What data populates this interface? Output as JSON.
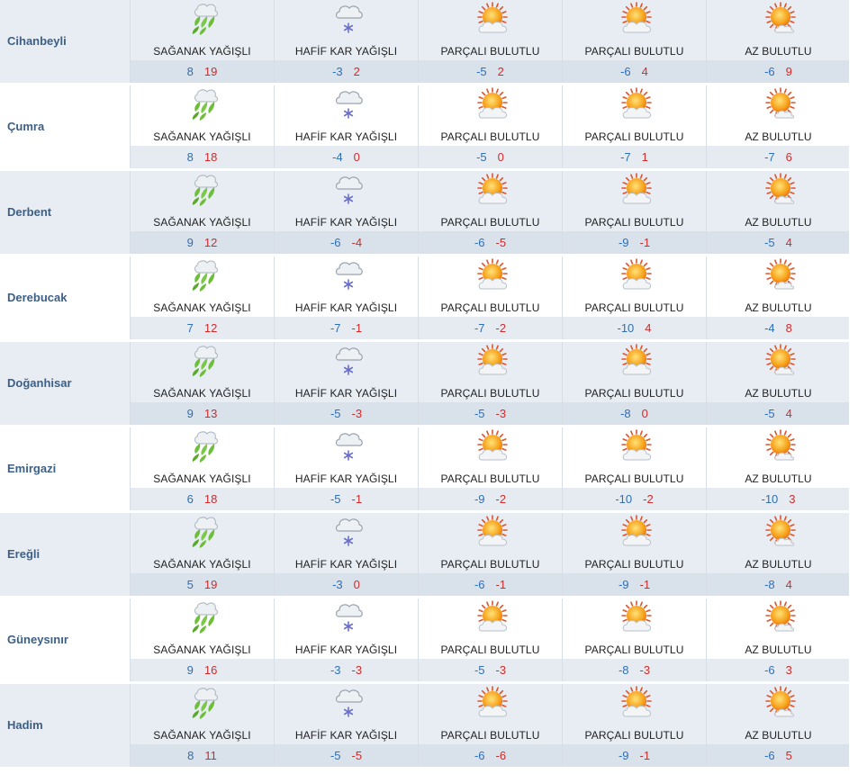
{
  "columns": [
    "col1",
    "col2",
    "col3",
    "col4",
    "col5"
  ],
  "icons": {
    "shower": "shower-rain-icon",
    "snow": "light-snow-icon",
    "partly": "partly-cloudy-icon",
    "few": "few-clouds-icon"
  },
  "colors": {
    "min_temp": "#2f6fb3",
    "max_temp": "#d02b2b",
    "city": "#3c5f86"
  },
  "rows": [
    {
      "city": "Cihanbeyli",
      "days": [
        {
          "cond": "SAĞANAK YAĞIŞLI",
          "icon": "shower",
          "min": "8",
          "max": "19"
        },
        {
          "cond": "HAFİF KAR YAĞIŞLI",
          "icon": "snow",
          "min": "-3",
          "max": "2"
        },
        {
          "cond": "PARÇALI BULUTLU",
          "icon": "partly",
          "min": "-5",
          "max": "2"
        },
        {
          "cond": "PARÇALI BULUTLU",
          "icon": "partly",
          "min": "-6",
          "max": "4"
        },
        {
          "cond": "AZ BULUTLU",
          "icon": "few",
          "min": "-6",
          "max": "9"
        }
      ]
    },
    {
      "city": "Çumra",
      "days": [
        {
          "cond": "SAĞANAK YAĞIŞLI",
          "icon": "shower",
          "min": "8",
          "max": "18"
        },
        {
          "cond": "HAFİF KAR YAĞIŞLI",
          "icon": "snow",
          "min": "-4",
          "max": "0"
        },
        {
          "cond": "PARÇALI BULUTLU",
          "icon": "partly",
          "min": "-5",
          "max": "0"
        },
        {
          "cond": "PARÇALI BULUTLU",
          "icon": "partly",
          "min": "-7",
          "max": "1"
        },
        {
          "cond": "AZ BULUTLU",
          "icon": "few",
          "min": "-7",
          "max": "6"
        }
      ]
    },
    {
      "city": "Derbent",
      "days": [
        {
          "cond": "SAĞANAK YAĞIŞLI",
          "icon": "shower",
          "min": "9",
          "max": "12"
        },
        {
          "cond": "HAFİF KAR YAĞIŞLI",
          "icon": "snow",
          "min": "-6",
          "max": "-4"
        },
        {
          "cond": "PARÇALI BULUTLU",
          "icon": "partly",
          "min": "-6",
          "max": "-5"
        },
        {
          "cond": "PARÇALI BULUTLU",
          "icon": "partly",
          "min": "-9",
          "max": "-1"
        },
        {
          "cond": "AZ BULUTLU",
          "icon": "few",
          "min": "-5",
          "max": "4"
        }
      ]
    },
    {
      "city": "Derebucak",
      "days": [
        {
          "cond": "SAĞANAK YAĞIŞLI",
          "icon": "shower",
          "min": "7",
          "max": "12"
        },
        {
          "cond": "HAFİF KAR YAĞIŞLI",
          "icon": "snow",
          "min": "-7",
          "max": "-1"
        },
        {
          "cond": "PARÇALI BULUTLU",
          "icon": "partly",
          "min": "-7",
          "max": "-2"
        },
        {
          "cond": "PARÇALI BULUTLU",
          "icon": "partly",
          "min": "-10",
          "max": "4"
        },
        {
          "cond": "AZ BULUTLU",
          "icon": "few",
          "min": "-4",
          "max": "8"
        }
      ]
    },
    {
      "city": "Doğanhisar",
      "days": [
        {
          "cond": "SAĞANAK YAĞIŞLI",
          "icon": "shower",
          "min": "9",
          "max": "13"
        },
        {
          "cond": "HAFİF KAR YAĞIŞLI",
          "icon": "snow",
          "min": "-5",
          "max": "-3"
        },
        {
          "cond": "PARÇALI BULUTLU",
          "icon": "partly",
          "min": "-5",
          "max": "-3"
        },
        {
          "cond": "PARÇALI BULUTLU",
          "icon": "partly",
          "min": "-8",
          "max": "0"
        },
        {
          "cond": "AZ BULUTLU",
          "icon": "few",
          "min": "-5",
          "max": "4"
        }
      ]
    },
    {
      "city": "Emirgazi",
      "days": [
        {
          "cond": "SAĞANAK YAĞIŞLI",
          "icon": "shower",
          "min": "6",
          "max": "18"
        },
        {
          "cond": "HAFİF KAR YAĞIŞLI",
          "icon": "snow",
          "min": "-5",
          "max": "-1"
        },
        {
          "cond": "PARÇALI BULUTLU",
          "icon": "partly",
          "min": "-9",
          "max": "-2"
        },
        {
          "cond": "PARÇALI BULUTLU",
          "icon": "partly",
          "min": "-10",
          "max": "-2"
        },
        {
          "cond": "AZ BULUTLU",
          "icon": "few",
          "min": "-10",
          "max": "3"
        }
      ]
    },
    {
      "city": "Ereğli",
      "days": [
        {
          "cond": "SAĞANAK YAĞIŞLI",
          "icon": "shower",
          "min": "5",
          "max": "19"
        },
        {
          "cond": "HAFİF KAR YAĞIŞLI",
          "icon": "snow",
          "min": "-3",
          "max": "0"
        },
        {
          "cond": "PARÇALI BULUTLU",
          "icon": "partly",
          "min": "-6",
          "max": "-1"
        },
        {
          "cond": "PARÇALI BULUTLU",
          "icon": "partly",
          "min": "-9",
          "max": "-1"
        },
        {
          "cond": "AZ BULUTLU",
          "icon": "few",
          "min": "-8",
          "max": "4"
        }
      ]
    },
    {
      "city": "Güneysınır",
      "days": [
        {
          "cond": "SAĞANAK YAĞIŞLI",
          "icon": "shower",
          "min": "9",
          "max": "16"
        },
        {
          "cond": "HAFİF KAR YAĞIŞLI",
          "icon": "snow",
          "min": "-3",
          "max": "-3"
        },
        {
          "cond": "PARÇALI BULUTLU",
          "icon": "partly",
          "min": "-5",
          "max": "-3"
        },
        {
          "cond": "PARÇALI BULUTLU",
          "icon": "partly",
          "min": "-8",
          "max": "-3"
        },
        {
          "cond": "AZ BULUTLU",
          "icon": "few",
          "min": "-6",
          "max": "3"
        }
      ]
    },
    {
      "city": "Hadim",
      "days": [
        {
          "cond": "SAĞANAK YAĞIŞLI",
          "icon": "shower",
          "min": "8",
          "max": "11"
        },
        {
          "cond": "HAFİF KAR YAĞIŞLI",
          "icon": "snow",
          "min": "-5",
          "max": "-5"
        },
        {
          "cond": "PARÇALI BULUTLU",
          "icon": "partly",
          "min": "-6",
          "max": "-6"
        },
        {
          "cond": "PARÇALI BULUTLU",
          "icon": "partly",
          "min": "-9",
          "max": "-1"
        },
        {
          "cond": "AZ BULUTLU",
          "icon": "few",
          "min": "-6",
          "max": "5"
        }
      ]
    }
  ]
}
